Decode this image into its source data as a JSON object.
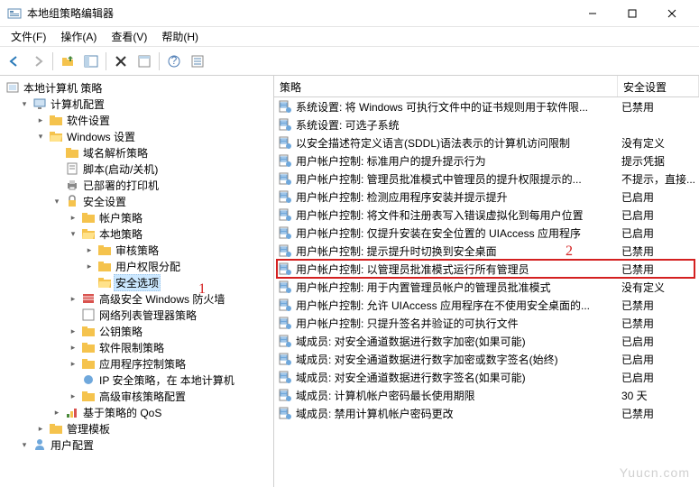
{
  "window": {
    "title": "本地组策略编辑器"
  },
  "menu": {
    "file": "文件(F)",
    "action": "操作(A)",
    "view": "查看(V)",
    "help": "帮助(H)"
  },
  "treeHeader": "本地计算机 策略",
  "tree": {
    "n0": "计算机配置",
    "n1": "软件设置",
    "n2": "Windows 设置",
    "n3": "域名解析策略",
    "n4": "脚本(启动/关机)",
    "n5": "已部署的打印机",
    "n6": "安全设置",
    "n7": "帐户策略",
    "n8": "本地策略",
    "n9": "审核策略",
    "n10": "用户权限分配",
    "n11": "安全选项",
    "n12": "高级安全 Windows 防火墙",
    "n13": "网络列表管理器策略",
    "n14": "公钥策略",
    "n15": "软件限制策略",
    "n16": "应用程序控制策略",
    "n17": "IP 安全策略，在 本地计算机",
    "n18": "高级审核策略配置",
    "n19": "基于策略的 QoS",
    "n20": "管理模板",
    "n21": "用户配置"
  },
  "listHeader": {
    "policy": "策略",
    "setting": "安全设置"
  },
  "policies": [
    {
      "name": "系统设置: 将 Windows 可执行文件中的证书规则用于软件限...",
      "setting": "已禁用"
    },
    {
      "name": "系统设置: 可选子系统",
      "setting": ""
    },
    {
      "name": "以安全描述符定义语言(SDDL)语法表示的计算机访问限制",
      "setting": "没有定义"
    },
    {
      "name": "用户帐户控制: 标准用户的提升提示行为",
      "setting": "提示凭据"
    },
    {
      "name": "用户帐户控制: 管理员批准模式中管理员的提升权限提示的...",
      "setting": "不提示，直接..."
    },
    {
      "name": "用户帐户控制: 检测应用程序安装并提示提升",
      "setting": "已启用"
    },
    {
      "name": "用户帐户控制: 将文件和注册表写入错误虚拟化到每用户位置",
      "setting": "已启用"
    },
    {
      "name": "用户帐户控制: 仅提升安装在安全位置的 UIAccess 应用程序",
      "setting": "已启用"
    },
    {
      "name": "用户帐户控制: 提示提升时切换到安全桌面",
      "setting": "已禁用"
    },
    {
      "name": "用户帐户控制: 以管理员批准模式运行所有管理员",
      "setting": "已禁用",
      "highlighted": true
    },
    {
      "name": "用户帐户控制: 用于内置管理员帐户的管理员批准模式",
      "setting": "没有定义"
    },
    {
      "name": "用户帐户控制: 允许 UIAccess 应用程序在不使用安全桌面的...",
      "setting": "已禁用"
    },
    {
      "name": "用户帐户控制: 只提升签名并验证的可执行文件",
      "setting": "已禁用"
    },
    {
      "name": "域成员: 对安全通道数据进行数字加密(如果可能)",
      "setting": "已启用"
    },
    {
      "name": "域成员: 对安全通道数据进行数字加密或数字签名(始终)",
      "setting": "已启用"
    },
    {
      "name": "域成员: 对安全通道数据进行数字签名(如果可能)",
      "setting": "已启用"
    },
    {
      "name": "域成员: 计算机帐户密码最长使用期限",
      "setting": "30 天"
    },
    {
      "name": "域成员: 禁用计算机帐户密码更改",
      "setting": "已禁用"
    }
  ],
  "annotations": {
    "one": "1",
    "two": "2"
  },
  "watermark": "Yuucn.com"
}
